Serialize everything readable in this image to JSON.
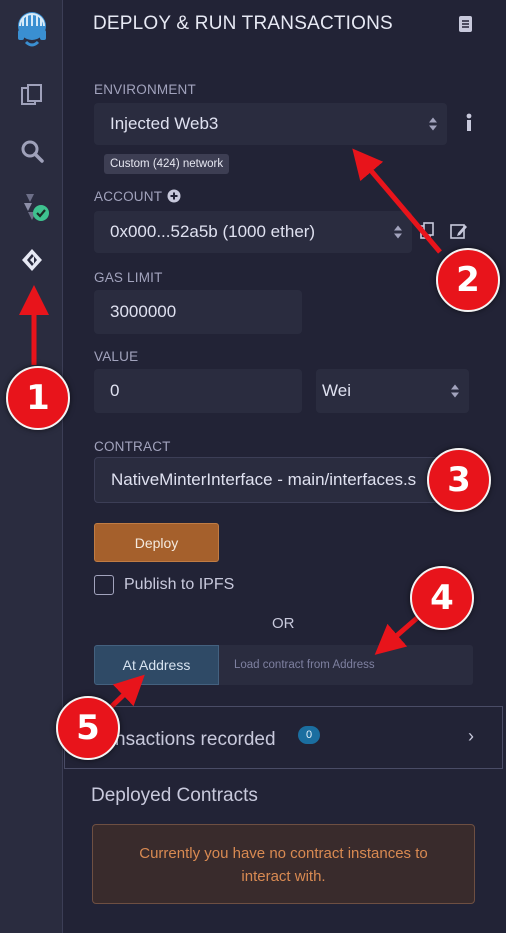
{
  "panel": {
    "title": "DEPLOY & RUN TRANSACTIONS"
  },
  "environment": {
    "label": "ENVIRONMENT",
    "value": "Injected Web3",
    "network_badge": "Custom (424) network"
  },
  "account": {
    "label": "ACCOUNT",
    "value": "0x000...52a5b (1000 ether)"
  },
  "gas_limit": {
    "label": "GAS LIMIT",
    "value": "3000000"
  },
  "value_field": {
    "label": "VALUE",
    "amount": "0",
    "unit": "Wei"
  },
  "contract": {
    "label": "CONTRACT",
    "value": "NativeMinterInterface - main/interfaces.s"
  },
  "actions": {
    "deploy_label": "Deploy",
    "publish_label": "Publish to IPFS",
    "or_label": "OR",
    "at_address_label": "At Address",
    "load_placeholder": "Load contract from Address"
  },
  "transactions": {
    "label": "nsactions recorded",
    "count": "0"
  },
  "deployed": {
    "title": "Deployed Contracts",
    "empty_message": "Currently you have no contract instances to interact with."
  },
  "annotations": {
    "step1": "1",
    "step2": "2",
    "step3": "3",
    "step4": "4",
    "step5": "5"
  },
  "colors": {
    "accent_deploy": "#a5602c",
    "annotation_red": "#e8141b",
    "badge_blue": "#1b6ea0"
  }
}
